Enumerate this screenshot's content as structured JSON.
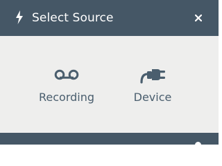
{
  "dialog": {
    "title": "Select Source",
    "title_icon": "bolt-icon",
    "close_icon": "close-icon"
  },
  "sources": [
    {
      "label": "Recording",
      "icon": "voicemail-icon"
    },
    {
      "label": "Device",
      "icon": "plug-icon"
    }
  ],
  "colors": {
    "header": "#455766",
    "body": "#eeeeed",
    "accent": "#4a5e6e"
  }
}
